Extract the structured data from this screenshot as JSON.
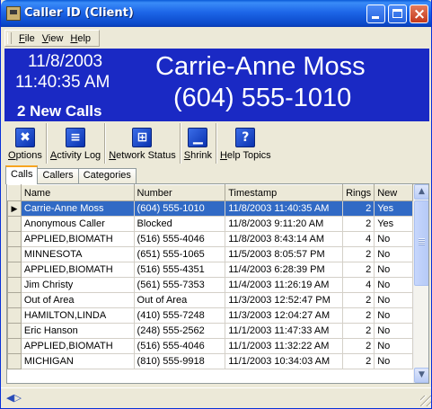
{
  "window": {
    "title": "Caller ID (Client)",
    "titlebar_color": "#0a48c8"
  },
  "menu": {
    "items": [
      "File",
      "View",
      "Help"
    ]
  },
  "banner": {
    "date": "11/8/2003",
    "time": "11:40:35 AM",
    "new_calls": "2 New Calls",
    "caller_name": "Carrie-Anne Moss",
    "caller_number": "(604) 555-1010",
    "background_color": "#1a29c4"
  },
  "toolbar": {
    "options": "Options",
    "activity_log": "Activity Log",
    "network_status": "Network Status",
    "shrink": "Shrink",
    "help_topics": "Help Topics"
  },
  "tabs": [
    "Calls",
    "Callers",
    "Categories"
  ],
  "grid": {
    "columns": [
      "Name",
      "Number",
      "Timestamp",
      "Rings",
      "New"
    ],
    "selected_row": 0,
    "rows": [
      {
        "name": "Carrie-Anne Moss",
        "number": "(604) 555-1010",
        "timestamp": "11/8/2003 11:40:35 AM",
        "rings": "2",
        "new": "Yes"
      },
      {
        "name": "Anonymous Caller",
        "number": "Blocked",
        "timestamp": "11/8/2003 9:11:20 AM",
        "rings": "2",
        "new": "Yes"
      },
      {
        "name": "APPLIED,BIOMATH",
        "number": "(516) 555-4046",
        "timestamp": "11/8/2003 8:43:14 AM",
        "rings": "4",
        "new": "No"
      },
      {
        "name": "MINNESOTA",
        "number": "(651) 555-1065",
        "timestamp": "11/5/2003 8:05:57 PM",
        "rings": "2",
        "new": "No"
      },
      {
        "name": "APPLIED,BIOMATH",
        "number": "(516) 555-4351",
        "timestamp": "11/4/2003 6:28:39 PM",
        "rings": "2",
        "new": "No"
      },
      {
        "name": "Jim Christy",
        "number": "(561) 555-7353",
        "timestamp": "11/4/2003 11:26:19 AM",
        "rings": "4",
        "new": "No"
      },
      {
        "name": "Out of Area",
        "number": "Out of Area",
        "timestamp": "11/3/2003 12:52:47 PM",
        "rings": "2",
        "new": "No"
      },
      {
        "name": "HAMILTON,LINDA",
        "number": "(410) 555-7248",
        "timestamp": "11/3/2003 12:04:27 AM",
        "rings": "2",
        "new": "No"
      },
      {
        "name": "Eric Hanson",
        "number": "(248) 555-2562",
        "timestamp": "11/1/2003 11:47:33 AM",
        "rings": "2",
        "new": "No"
      },
      {
        "name": "APPLIED,BIOMATH",
        "number": "(516) 555-4046",
        "timestamp": "11/1/2003 11:32:22 AM",
        "rings": "2",
        "new": "No"
      },
      {
        "name": "MICHIGAN",
        "number": "(810) 555-9918",
        "timestamp": "11/1/2003 10:34:03 AM",
        "rings": "2",
        "new": "No"
      }
    ]
  },
  "selection_color": "#316ac5"
}
